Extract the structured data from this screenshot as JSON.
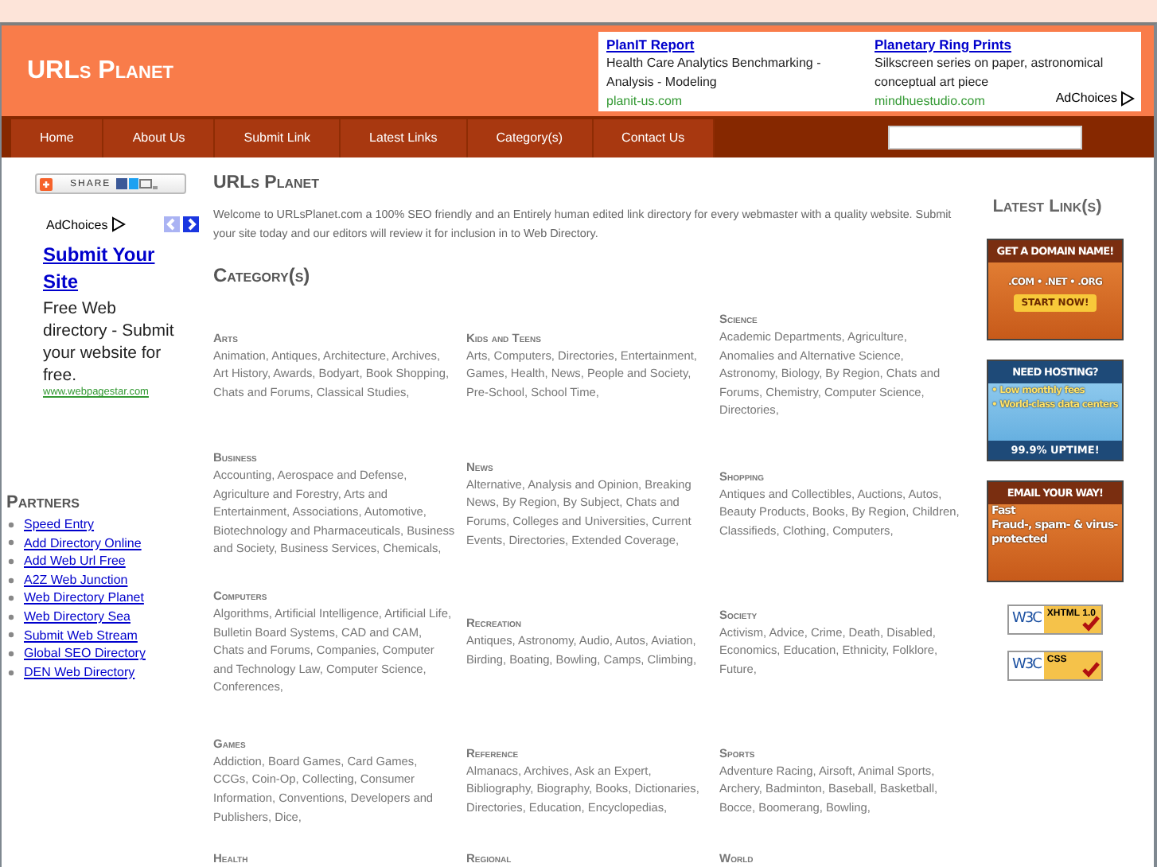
{
  "site_title": "URLs Planet",
  "top_ads": [
    {
      "title": "PlanIT Report",
      "text": "Health Care Analytics Benchmarking - Analysis - Modeling",
      "url": "planit-us.com"
    },
    {
      "title": "Planetary Ring Prints",
      "text": "Silkscreen series on paper, astronomical conceptual art piece",
      "url": "mindhuestudio.com"
    }
  ],
  "top_adchoices": "AdChoices",
  "nav": [
    "Home",
    "About Us",
    "Submit Link",
    "Latest Links",
    "Category(s)",
    "Contact Us"
  ],
  "share_button": "SHARE",
  "side_ad": {
    "adchoices": "AdChoices",
    "title": "Submit Your Site",
    "text": "Free Web directory - Submit your website for free.",
    "url": "www.webpagestar.com"
  },
  "partners": {
    "title": "Partners",
    "links": [
      "Speed Entry",
      "Add Directory Online",
      "Add Web Url Free",
      "A2Z Web Junction",
      "Web Directory Planet",
      "Web Directory Sea",
      "Submit Web Stream",
      "Global SEO Directory",
      "DEN Web Directory"
    ]
  },
  "main": {
    "title": "URLs Planet",
    "welcome": "Welcome to URLsPlanet.com a 100% SEO friendly and an Entirely human edited link directory for every webmaster with a quality website. Submit your site today and our editors will review it for inclusion in to Web Directory.",
    "categories_title": "Category(s)"
  },
  "categories": [
    {
      "name": "Arts",
      "subs": "Animation, Antiques, Architecture, Archives, Art History, Awards, Bodyart, Book Shopping, Chats and Forums, Classical Studies,"
    },
    {
      "name": "Kids and Teens",
      "subs": "Arts, Computers, Directories, Entertainment, Games, Health, News, People and Society, Pre-School, School Time,"
    },
    {
      "name": "Science",
      "subs": "Academic Departments, Agriculture, Anomalies and Alternative Science, Astronomy, Biology, By Region, Chats and Forums, Chemistry, Computer Science, Directories,"
    },
    {
      "name": "Business",
      "subs": "Accounting, Aerospace and Defense, Agriculture and Forestry, Arts and Entertainment, Associations, Automotive, Biotechnology and Pharmaceuticals, Business and Society, Business Services, Chemicals,"
    },
    {
      "name": "News",
      "subs": "Alternative, Analysis and Opinion, Breaking News, By Region, By Subject, Chats and Forums, Colleges and Universities, Current Events, Directories, Extended Coverage,"
    },
    {
      "name": "Shopping",
      "subs": "Antiques and Collectibles, Auctions, Autos, Beauty Products, Books, By Region, Children, Classifieds, Clothing, Computers,"
    },
    {
      "name": "Computers",
      "subs": "Algorithms, Artificial Intelligence, Artificial Life, Bulletin Board Systems, CAD and CAM, Chats and Forums, Companies, Computer and Technology Law, Computer Science, Conferences,"
    },
    {
      "name": "Recreation",
      "subs": "Antiques, Astronomy, Audio, Autos, Aviation, Birding, Boating, Bowling, Camps, Climbing,"
    },
    {
      "name": "Society",
      "subs": "Activism, Advice, Crime, Death, Disabled, Economics, Education, Ethnicity, Folklore, Future,"
    },
    {
      "name": "Games",
      "subs": "Addiction, Board Games, Card Games, CCGs, Coin-Op, Collecting, Consumer Information, Conventions, Developers and Publishers, Dice,"
    },
    {
      "name": "Reference",
      "subs": "Almanacs, Archives, Ask an Expert, Bibliography, Biography, Books, Dictionaries, Directories, Education, Encyclopedias,"
    },
    {
      "name": "Sports",
      "subs": "Adventure Racing, Airsoft, Animal Sports, Archery, Badminton, Baseball, Basketball, Bocce, Boomerang, Bowling,"
    },
    {
      "name": "Health"
    },
    {
      "name": "Regional"
    },
    {
      "name": "World"
    }
  ],
  "latest_title": "Latest Link(s)",
  "banners": [
    {
      "kind": "domain",
      "headline": "GET A DOMAIN NAME!",
      "lines": [
        ".COM • .NET • .ORG"
      ],
      "button": "START NOW!"
    },
    {
      "kind": "hosting",
      "headline": "NEED HOSTING?",
      "lines": [
        "• Low monthly fees",
        "• World-class data centers"
      ],
      "footer": "99.9% UPTIME!"
    },
    {
      "kind": "email",
      "headline": "EMAIL YOUR WAY!",
      "lines": [
        "Fast",
        "Fraud-, spam- & virus-protected"
      ]
    }
  ],
  "badges": [
    {
      "logo": "W3C",
      "label": "XHTML 1.0"
    },
    {
      "logo": "W3C",
      "label": "CSS"
    }
  ]
}
